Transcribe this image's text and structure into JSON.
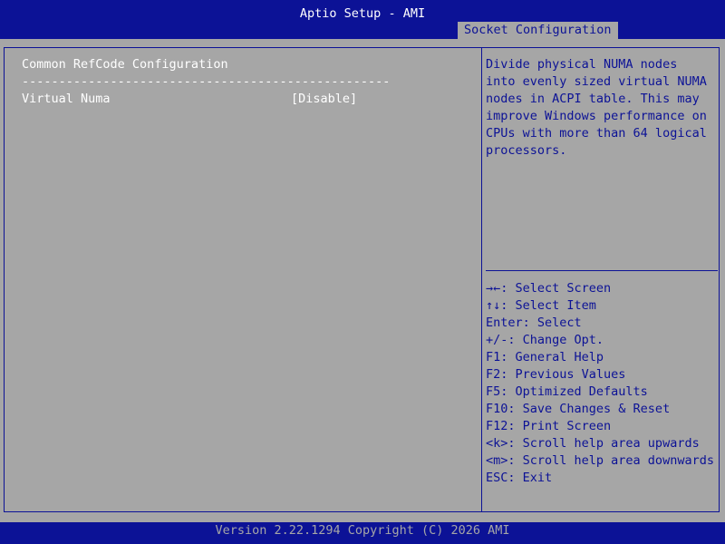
{
  "header": {
    "title": "Aptio Setup - AMI",
    "active_tab": "Socket Configuration"
  },
  "main": {
    "section_title": "Common RefCode Configuration",
    "separator": "--------------------------------------------------",
    "settings": [
      {
        "label": "Virtual Numa",
        "value": "[Disable]"
      }
    ]
  },
  "help": {
    "lines": [
      "Divide physical NUMA nodes",
      "into evenly sized virtual NUMA",
      "nodes in ACPI table. This may",
      "improve Windows performance on",
      "CPUs with more than 64 logical",
      "processors."
    ]
  },
  "keys": [
    "→←: Select Screen",
    "↑↓: Select Item",
    "Enter: Select",
    "+/-: Change Opt.",
    "F1: General Help",
    "F2: Previous Values",
    "F5: Optimized Defaults",
    "F10: Save Changes & Reset",
    "F12: Print Screen",
    "<k>: Scroll help area upwards",
    "<m>: Scroll help area downwards",
    "ESC: Exit"
  ],
  "footer": {
    "version": "Version 2.22.1294 Copyright (C) 2026 AMI"
  },
  "colors": {
    "bios_blue": "#0c1296",
    "bios_gray": "#a6a6a6",
    "text_white": "#ffffff"
  }
}
